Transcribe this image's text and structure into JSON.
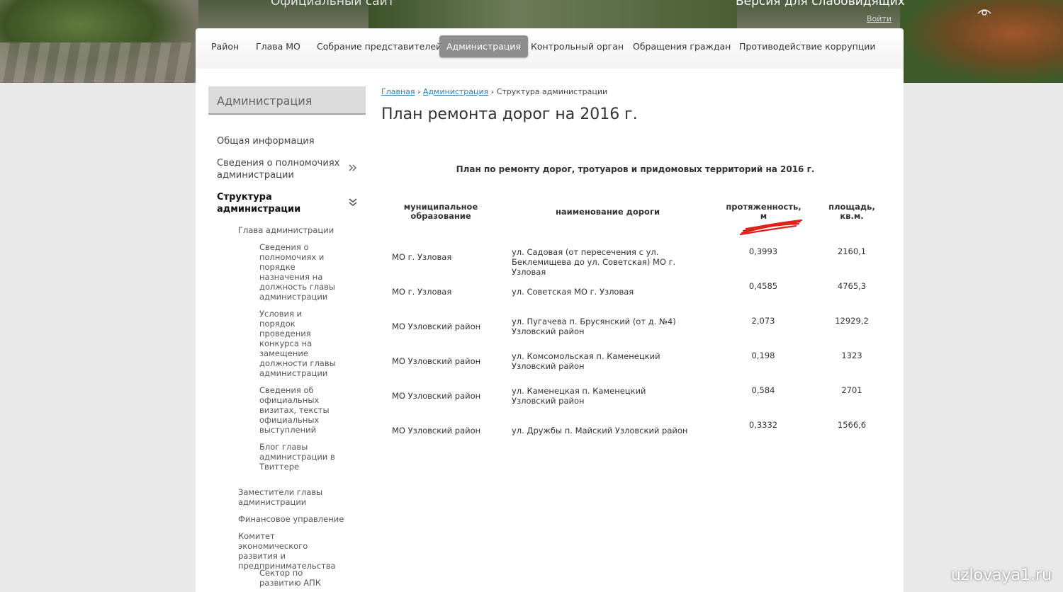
{
  "header": {
    "site_title": "Официальный сайт",
    "vision_link": "Версия для слабовидящих",
    "login": "Войти"
  },
  "nav": {
    "items": [
      {
        "label": "Район"
      },
      {
        "label": "Глава МО"
      },
      {
        "label": "Собрание представителей"
      },
      {
        "label": "Администрация"
      },
      {
        "label": "Контрольный орган"
      },
      {
        "label": "Обращения граждан"
      },
      {
        "label": "Противодействие коррупции"
      }
    ],
    "active": "Администрация"
  },
  "sidebar": {
    "heading": "Администрация",
    "items": [
      {
        "label": "Общая информация"
      },
      {
        "label": "Сведения о полномочиях администрации"
      },
      {
        "label": "Структура администрации"
      }
    ],
    "sub": [
      {
        "label": "Глава администрации"
      },
      {
        "label": "Заместители главы администрации"
      },
      {
        "label": "Финансовое управление"
      },
      {
        "label": "Комитет экономического развития и предпринимательства"
      }
    ],
    "subsub": [
      {
        "label": "Сведения о полномочиях и порядке назначения на должность главы администрации"
      },
      {
        "label": "Условия и порядок проведения конкурса на замещение должности главы администрации"
      },
      {
        "label": "Сведения об официальных визитах, тексты официальных выступлений"
      },
      {
        "label": "Блог главы администрации в Твиттере"
      },
      {
        "label": "Сектор по развитию АПК"
      }
    ]
  },
  "breadcrumb": {
    "home": "Главная",
    "section": "Администрация",
    "sep": "›",
    "current": "Структура администрации"
  },
  "page": {
    "title": "План ремонта дорог на 2016 г.",
    "table_heading": "План по ремонту дорог, тротуаров и придомовых территорий на 2016 г."
  },
  "table": {
    "headers": {
      "municipality": "муниципальное образование",
      "road": "наименование дороги",
      "length": "протяженность, м",
      "area": "площадь, кв.м."
    },
    "rows": [
      {
        "municipality": "МО г. Узловая",
        "road": "ул. Садовая (от пересечения с ул. Беклемищева до ул. Советская) МО г. Узловая",
        "length": "0,3993",
        "area": "2160,1"
      },
      {
        "municipality": "МО г. Узловая",
        "road": "ул. Советская МО г. Узловая",
        "length": "0,4585",
        "area": "4765,3"
      },
      {
        "municipality": "МО Узловский район",
        "road": "ул. Пугачева п. Брусянский (от д. №4) Узловский район",
        "length": "2,073",
        "area": "12929,2"
      },
      {
        "municipality": "МО Узловский район",
        "road": "ул. Комсомольская п. Каменецкий Узловский район",
        "length": "0,198",
        "area": "1323"
      },
      {
        "municipality": "МО Узловский район",
        "road": "ул. Каменецкая п. Каменецкий Узловский район",
        "length": "0,584",
        "area": "2701"
      },
      {
        "municipality": "МО Узловский район",
        "road": "ул. Дружбы п. Майский Узловский район",
        "length": "0,3332",
        "area": "1566,6"
      }
    ]
  },
  "watermark": "uzlovaya1.ru",
  "colors": {
    "nav_active": "#8e8e8e",
    "link": "#3a7ca5",
    "scribble": "#e0201a"
  }
}
